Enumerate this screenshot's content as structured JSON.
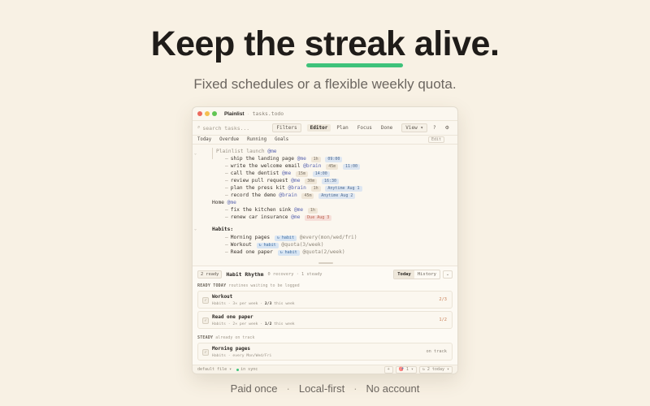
{
  "hero": {
    "headline_before": "Keep the",
    "headline_highlight": "streak",
    "headline_after": "alive.",
    "subhead": "Fixed schedules or a flexible weekly quota."
  },
  "colors": {
    "accent": "#3ec27a",
    "background": "#f8f1e4"
  },
  "window": {
    "app_title": "Plainlist",
    "title_sep": "·",
    "file_name": "tasks.todo",
    "search_placeholder": "search tasks...",
    "toolbar": {
      "filters": "Filters",
      "editor": "Editor",
      "plan": "Plan",
      "focus": "Focus",
      "done": "Done",
      "view": "View ▾",
      "help": "?",
      "settings_icon": "gear-icon"
    },
    "filter_tabs": [
      "Today",
      "Overdue",
      "Running",
      "Goals"
    ],
    "edit_label": "Edit",
    "editor": {
      "project1": {
        "name": "Plainlist launch",
        "mention": "@me"
      },
      "tasks1": [
        {
          "text": "ship the landing page",
          "mention": "@me",
          "dur": "1h",
          "time": "09:00"
        },
        {
          "text": "write the welcome email",
          "mention": "@brain",
          "dur": "45m",
          "time": "11:00"
        },
        {
          "text": "call the dentist",
          "mention": "@me",
          "dur": "15m",
          "time": "14:00"
        },
        {
          "text": "review pull request",
          "mention": "@me",
          "dur": "30m",
          "time": "16:30"
        },
        {
          "text": "plan the press kit",
          "mention": "@brain",
          "dur": "1h",
          "time": "Anytime Aug 1"
        },
        {
          "text": "record the demo",
          "mention": "@brain",
          "dur": "45m",
          "time": "Anytime Aug 2"
        }
      ],
      "project2": {
        "name": "Home",
        "mention": "@me"
      },
      "tasks2": [
        {
          "text": "fix the kitchen sink",
          "mention": "@me",
          "dur": "1h"
        },
        {
          "text": "renew car insurance",
          "mention": "@me",
          "due": "Due Aug 3"
        }
      ],
      "habits_heading": "Habits:",
      "habits": [
        {
          "text": "Morning pages",
          "tag": "↻ habit",
          "rule": "@every(mon/wed/fri)"
        },
        {
          "text": "Workout",
          "tag": "↻ habit",
          "rule": "@quota(3/week)"
        },
        {
          "text": "Read one paper",
          "tag": "↻ habit",
          "rule": "@quota(2/week)"
        }
      ]
    },
    "panel": {
      "ready_pill": "2 ready",
      "title": "Habit Rhythm",
      "meta": "0 recovery · 1 steady",
      "seg_today": "Today",
      "seg_history": "History",
      "chevron": "⌄",
      "ready_label": "READY TODAY",
      "ready_sub": "routines waiting to be logged",
      "ready_cards": [
        {
          "name": "Workout",
          "list": "Habits",
          "rule": "3× per week",
          "progress": "2/3",
          "progress_suffix": "this week",
          "right": "2/3"
        },
        {
          "name": "Read one paper",
          "list": "Habits",
          "rule": "2× per week",
          "progress": "1/2",
          "progress_suffix": "this week",
          "right": "1/2"
        }
      ],
      "steady_label": "STEADY",
      "steady_sub": "already on track",
      "steady_cards": [
        {
          "name": "Morning pages",
          "list": "Habits",
          "rule": "every Mon/Wed/Fri",
          "right": "on track"
        }
      ]
    },
    "statusbar": {
      "file": "default file ▾",
      "sync": "in sync",
      "chip1": "+",
      "chip2": "🎯 1 ▾",
      "chip3": "↻ 2 today ▾"
    }
  },
  "footer": {
    "items": [
      "Paid once",
      "Local-first",
      "No account"
    ],
    "sep": "·"
  }
}
